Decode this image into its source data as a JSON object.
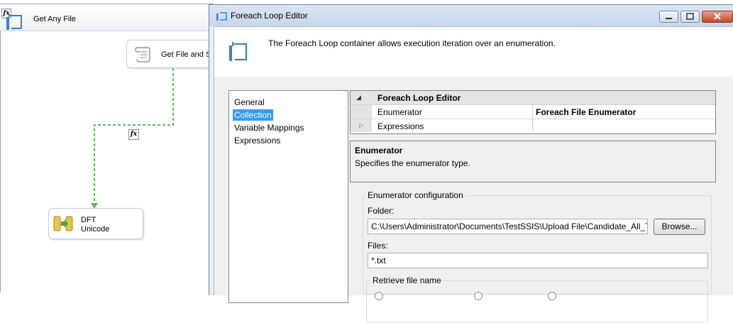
{
  "designer": {
    "container_title": "Get Any File",
    "script_task_label": "Get File and Se",
    "dft_task_label_line1": "DFT",
    "dft_task_label_line2": "Unicode",
    "fx_symbol": "fx"
  },
  "dialog": {
    "title": "Foreach Loop Editor",
    "description": "The Foreach Loop container allows execution iteration over an enumeration.",
    "nav_items": [
      "General",
      "Collection",
      "Variable Mappings",
      "Expressions"
    ],
    "selected_nav": "Collection",
    "property_grid": {
      "category": "Foreach Loop Editor",
      "rows": [
        {
          "name": "Enumerator",
          "value": "Foreach File Enumerator"
        },
        {
          "name": "Expressions",
          "value": ""
        }
      ]
    },
    "help": {
      "title": "Enumerator",
      "description": "Specifies the enumerator type."
    },
    "config": {
      "group_label": "Enumerator configuration",
      "folder_label": "Folder:",
      "folder_value": "C:\\Users\\Administrator\\Documents\\TestSSIS\\Upload File\\Candidate_All_T",
      "browse_label": "Browse...",
      "files_label": "Files:",
      "files_value": "*.txt",
      "retrieve_label": "Retrieve file name"
    }
  },
  "colors": {
    "selection": "#3399ff",
    "flow_arrow": "#5bb85b",
    "title_gradient_top": "#dbe6f4",
    "close_button": "#c4442c"
  },
  "icons": {
    "container": "foreach-loop-icon",
    "script_task": "script-scroll-icon",
    "dft": "data-flow-task-icon",
    "expression": "fx-expression-icon"
  }
}
